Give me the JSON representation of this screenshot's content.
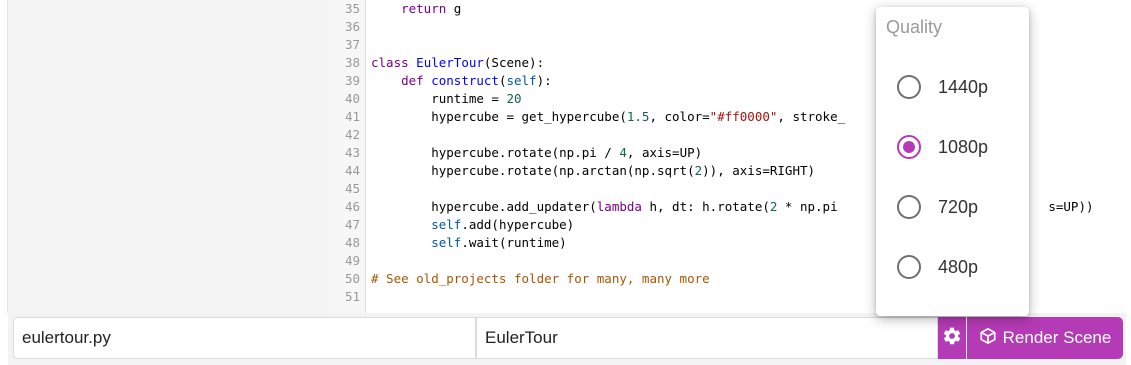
{
  "editor": {
    "lines": [
      {
        "n": "35",
        "tokens": [
          {
            "t": "    "
          },
          {
            "t": "return",
            "c": "kw"
          },
          {
            "t": " g"
          }
        ]
      },
      {
        "n": "36",
        "tokens": []
      },
      {
        "n": "37",
        "tokens": []
      },
      {
        "n": "38",
        "tokens": [
          {
            "t": "class",
            "c": "kw"
          },
          {
            "t": " "
          },
          {
            "t": "EulerTour",
            "c": "def"
          },
          {
            "t": "(Scene):"
          }
        ]
      },
      {
        "n": "39",
        "tokens": [
          {
            "t": "    "
          },
          {
            "t": "def",
            "c": "kw"
          },
          {
            "t": " "
          },
          {
            "t": "construct",
            "c": "def"
          },
          {
            "t": "("
          },
          {
            "t": "self",
            "c": "var2"
          },
          {
            "t": "):"
          }
        ]
      },
      {
        "n": "40",
        "tokens": [
          {
            "t": "        runtime = "
          },
          {
            "t": "20",
            "c": "num"
          }
        ]
      },
      {
        "n": "41",
        "tokens": [
          {
            "t": "        hypercube = get_hypercube("
          },
          {
            "t": "1.5",
            "c": "num"
          },
          {
            "t": ", color="
          },
          {
            "t": "\"#ff0000\"",
            "c": "str"
          },
          {
            "t": ", stroke_"
          }
        ]
      },
      {
        "n": "42",
        "tokens": []
      },
      {
        "n": "43",
        "tokens": [
          {
            "t": "        hypercube.rotate(np.pi / "
          },
          {
            "t": "4",
            "c": "num"
          },
          {
            "t": ", axis=UP)"
          }
        ]
      },
      {
        "n": "44",
        "tokens": [
          {
            "t": "        hypercube.rotate(np.arctan(np.sqrt("
          },
          {
            "t": "2",
            "c": "num"
          },
          {
            "t": ")), axis=RIGHT)"
          }
        ]
      },
      {
        "n": "45",
        "tokens": []
      },
      {
        "n": "46",
        "tokens": [
          {
            "t": "        hypercube.add_updater("
          },
          {
            "t": "lambda",
            "c": "kw"
          },
          {
            "t": " h, dt: h.rotate("
          },
          {
            "t": "2",
            "c": "num"
          },
          {
            "t": " * np.pi "
          },
          {
            "t": "                           "
          },
          {
            "t": "s=UP))"
          }
        ]
      },
      {
        "n": "47",
        "tokens": [
          {
            "t": "        "
          },
          {
            "t": "self",
            "c": "var2"
          },
          {
            "t": ".add(hypercube)"
          }
        ]
      },
      {
        "n": "48",
        "tokens": [
          {
            "t": "        "
          },
          {
            "t": "self",
            "c": "var2"
          },
          {
            "t": ".wait(runtime)"
          }
        ]
      },
      {
        "n": "49",
        "tokens": []
      },
      {
        "n": "50",
        "tokens": [
          {
            "t": "# See old_projects folder for many, many more",
            "c": "cmt"
          }
        ]
      },
      {
        "n": "51",
        "tokens": []
      }
    ]
  },
  "quality_menu": {
    "title": "Quality",
    "options": [
      {
        "label": "1440p",
        "selected": false
      },
      {
        "label": "1080p",
        "selected": true
      },
      {
        "label": "720p",
        "selected": false
      },
      {
        "label": "480p",
        "selected": false
      }
    ]
  },
  "bottom_bar": {
    "file_name": "eulertour.py",
    "scene_name": "EulerTour",
    "render_label": "Render Scene",
    "settings_icon": "gear-icon",
    "render_icon": "cube-icon"
  },
  "colors": {
    "accent": "#b53ab5"
  }
}
